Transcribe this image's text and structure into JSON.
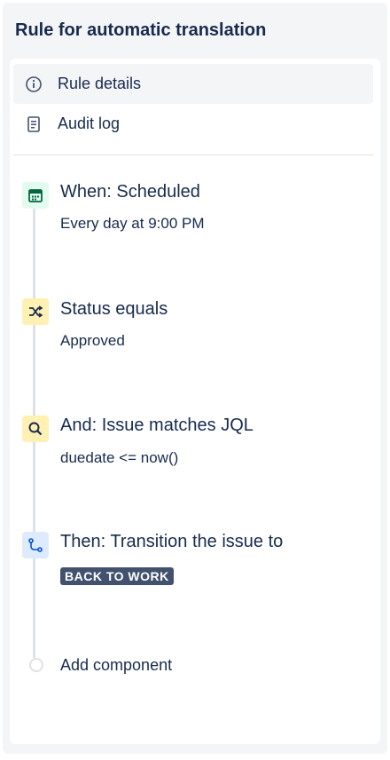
{
  "header": {
    "title": "Rule for automatic translation"
  },
  "nav": {
    "items": [
      {
        "label": "Rule details",
        "icon": "info-icon",
        "active": true
      },
      {
        "label": "Audit log",
        "icon": "document-icon",
        "active": false
      }
    ]
  },
  "steps": [
    {
      "title": "When: Scheduled",
      "subtitle": "Every day at 9:00 PM",
      "icon": "calendar-icon",
      "icon_bg": "#e3fcef",
      "icon_color": "#006644"
    },
    {
      "title": "Status equals",
      "subtitle": "Approved",
      "icon": "shuffle-icon",
      "icon_bg": "#fff0b3",
      "icon_color": "#172b4d"
    },
    {
      "title": "And: Issue matches JQL",
      "subtitle": "duedate <= now()",
      "icon": "search-icon",
      "icon_bg": "#fff0b3",
      "icon_color": "#172b4d"
    },
    {
      "title": "Then: Transition the issue to",
      "lozenge": "BACK TO WORK",
      "icon": "transition-icon",
      "icon_bg": "#deebff",
      "icon_color": "#0052cc"
    }
  ],
  "add_component": {
    "label": "Add component"
  }
}
